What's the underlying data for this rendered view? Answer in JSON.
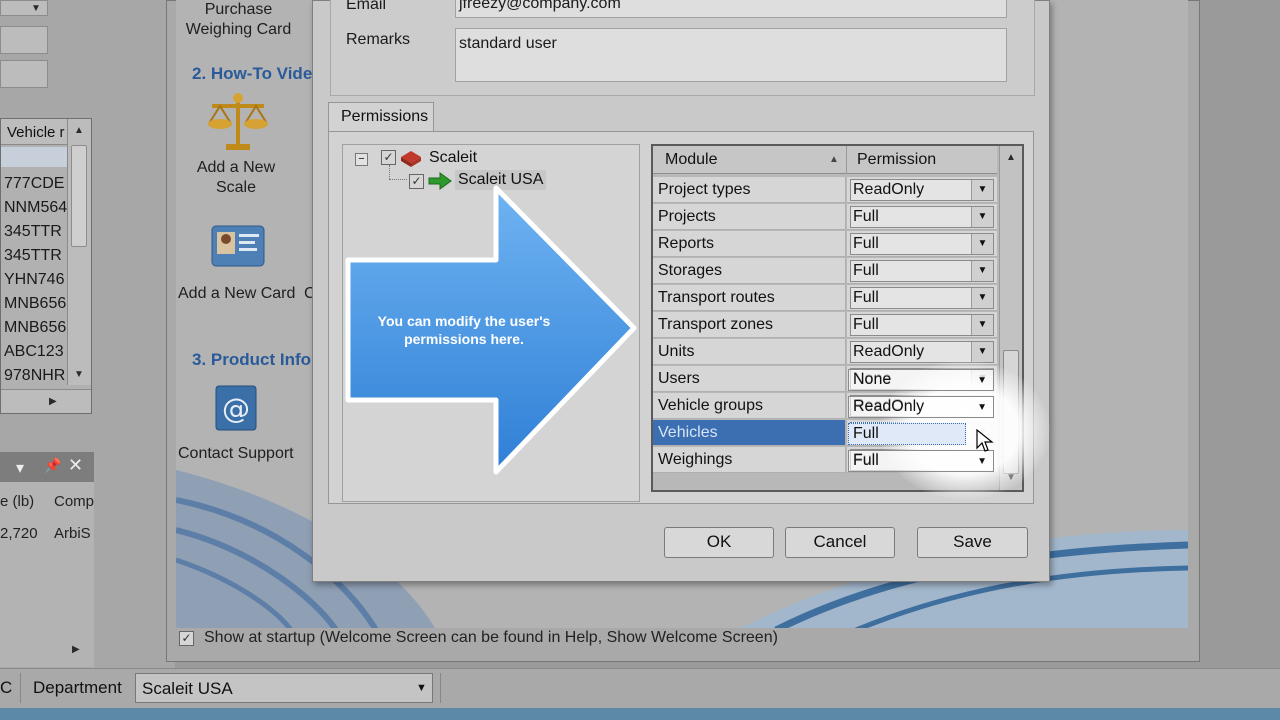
{
  "left_app": {
    "vehicle_list": {
      "header": "Vehicle r",
      "rows": [
        "777CDE",
        "NNM564",
        "345TTR",
        "345TTR",
        "YHN746",
        "MNB656",
        "MNB656",
        "ABC123",
        "978NHR"
      ]
    },
    "panel": {
      "col1": "e (lb)",
      "col2": "Comp",
      "row_val1": "2,720",
      "row_val2": "ArbiS"
    }
  },
  "welcome": {
    "purchase_card": "Purchase\nWeighing Card",
    "section2": "2. How-To Vide",
    "add_scale": "Add a New\nScale",
    "add_card": "Add a New Card",
    "add_card_suffix": "C",
    "section3": "3. Product Info",
    "contact_support": "Contact Support",
    "startup_text": "Show at startup (Welcome Screen can be found in Help, Show Welcome Screen)"
  },
  "statusbar": {
    "left_fragment": "C",
    "department_label": "Department",
    "department_value": "Scaleit USA"
  },
  "dialog": {
    "email_label": "Email",
    "email_value": "jfreezy@company.com",
    "remarks_label": "Remarks",
    "remarks_value": "standard user",
    "tab_label": "Permissions",
    "tree": {
      "root": "Scaleit",
      "child": "Scaleit USA"
    },
    "grid": {
      "col_module": "Module",
      "col_permission": "Permission",
      "rows": [
        {
          "module": "Project types",
          "permission": "ReadOnly"
        },
        {
          "module": "Projects",
          "permission": "Full"
        },
        {
          "module": "Reports",
          "permission": "Full"
        },
        {
          "module": "Storages",
          "permission": "Full"
        },
        {
          "module": "Transport routes",
          "permission": "Full"
        },
        {
          "module": "Transport zones",
          "permission": "Full"
        },
        {
          "module": "Units",
          "permission": "ReadOnly"
        },
        {
          "module": "Users",
          "permission": "None"
        },
        {
          "module": "Vehicle groups",
          "permission": "ReadOnly"
        },
        {
          "module": "Vehicles",
          "permission": "Full"
        },
        {
          "module": "Weighings",
          "permission": "Full"
        }
      ],
      "selected_module": "Vehicles"
    },
    "buttons": {
      "ok": "OK",
      "cancel": "Cancel",
      "save": "Save"
    }
  },
  "callout": {
    "text": "You can modify the user's permissions here."
  },
  "colors": {
    "arrow_blue": "#4a97e0",
    "selection_blue": "#3b6fb1",
    "section_blue": "#2a5a99"
  }
}
